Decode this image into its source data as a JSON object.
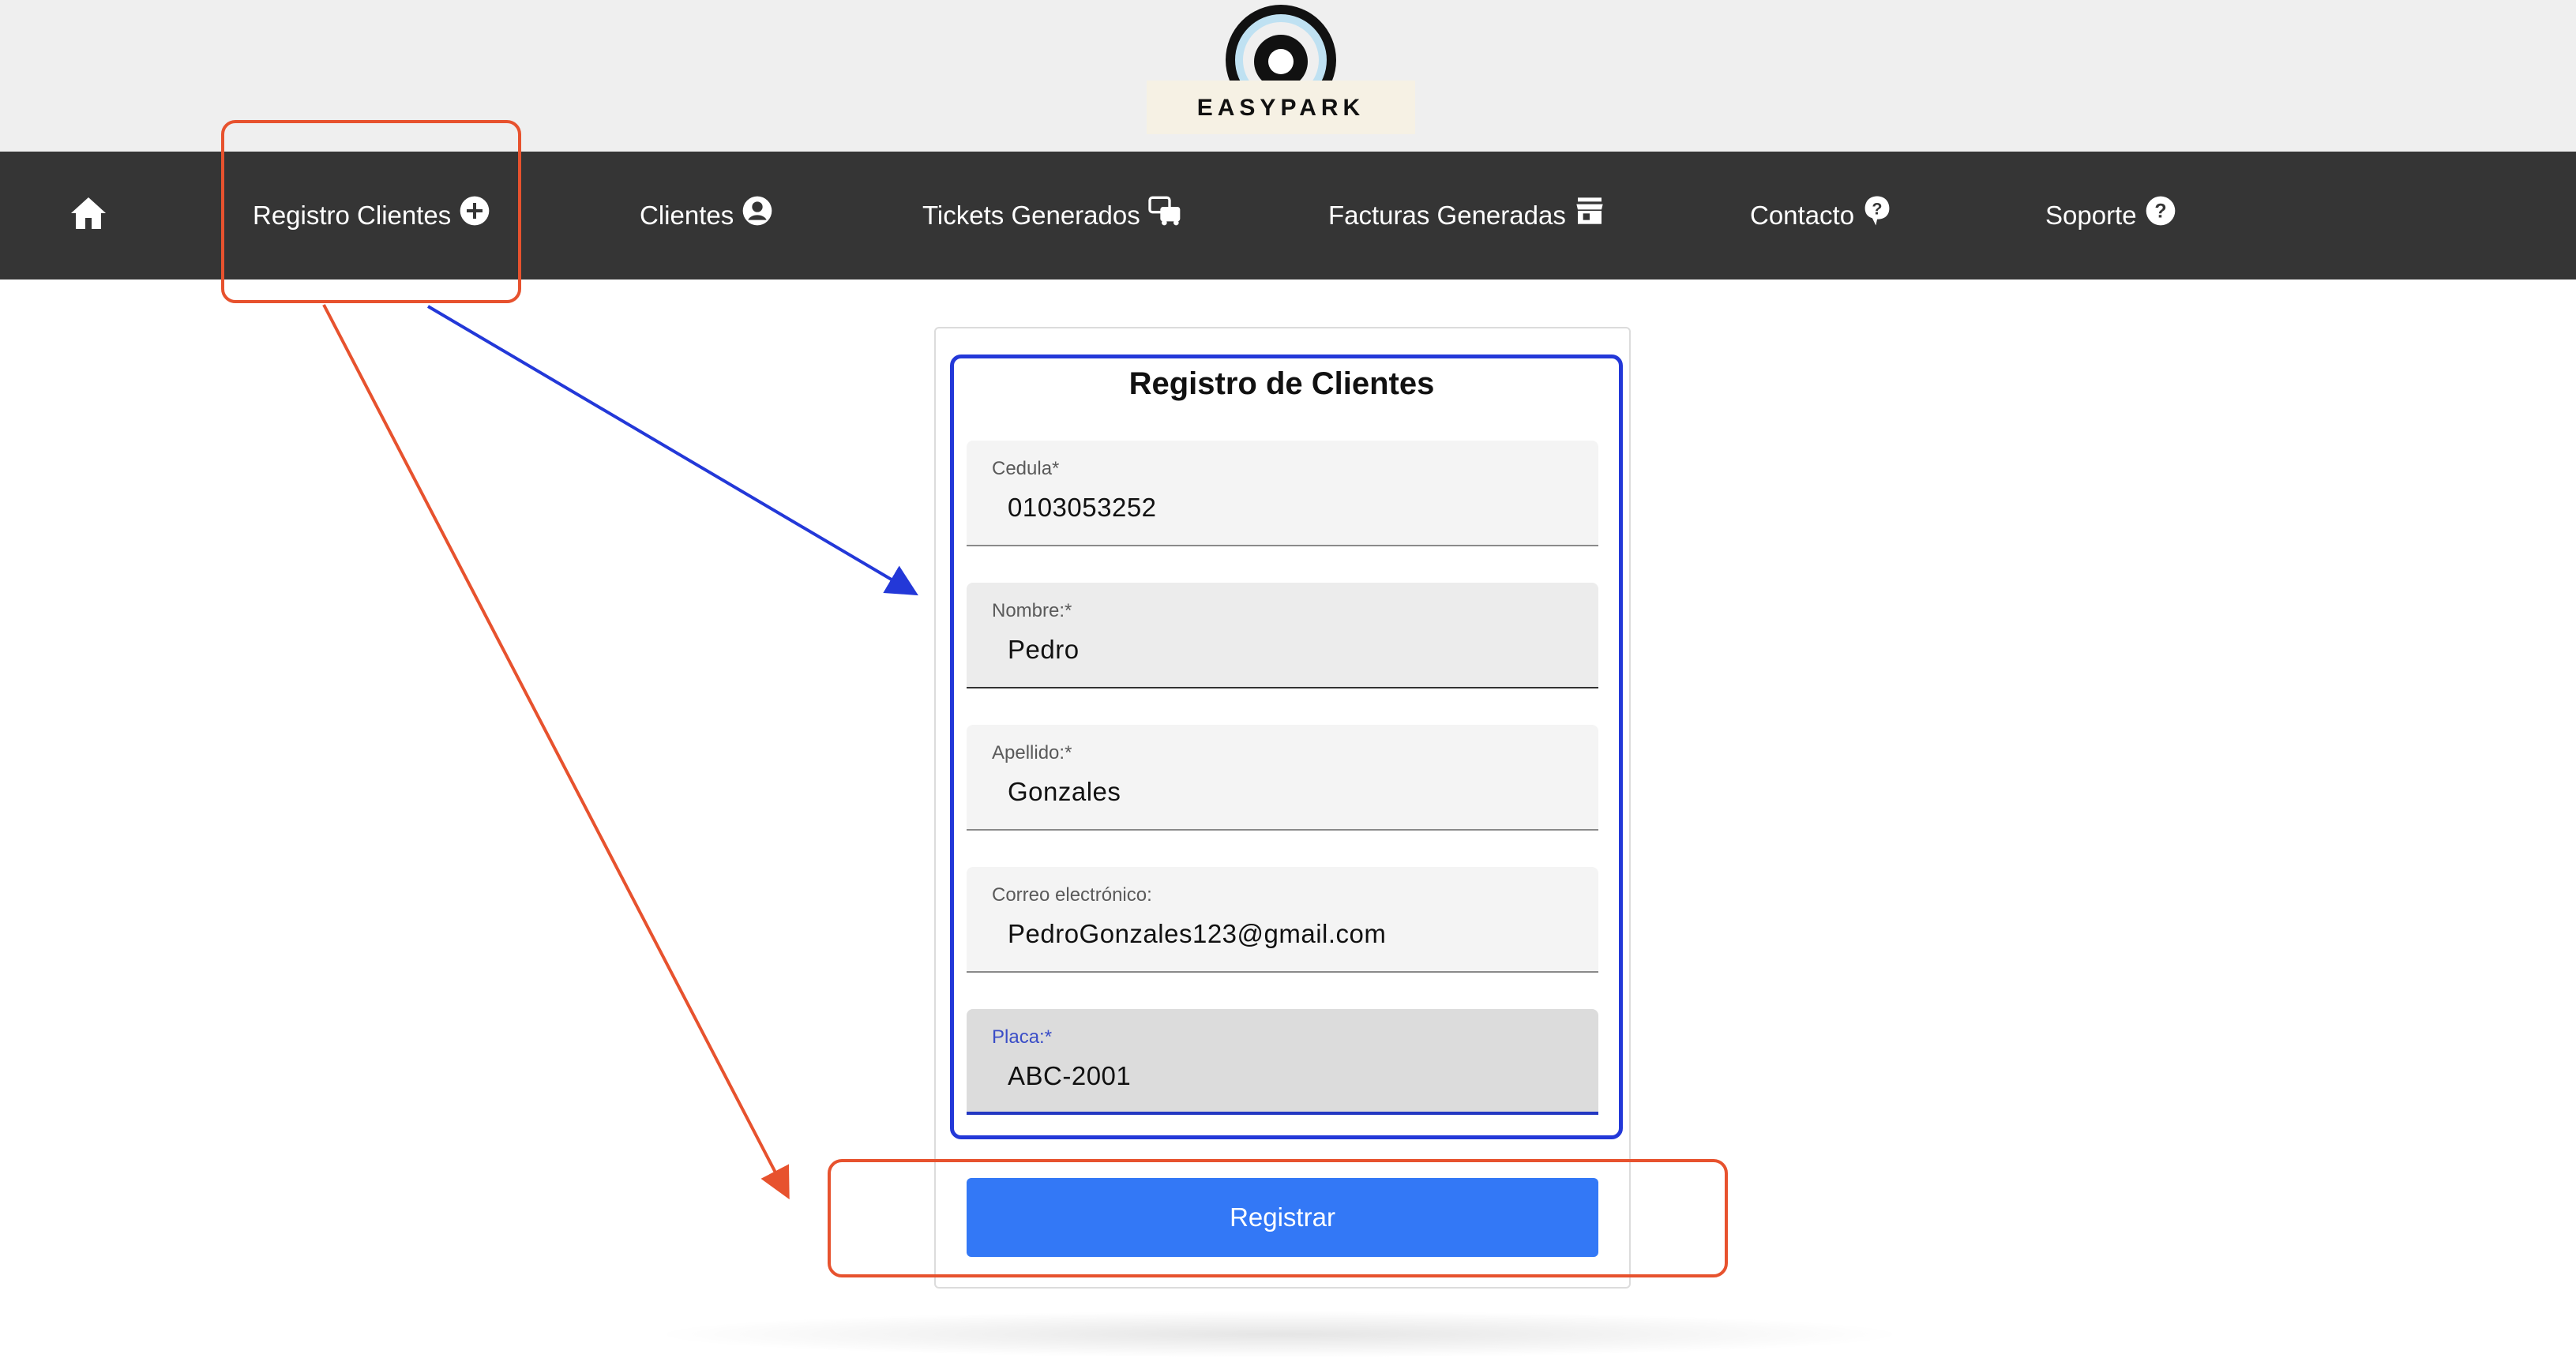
{
  "brand": {
    "name": "EASYPARK"
  },
  "nav": {
    "home_icon": "home-icon",
    "items": [
      {
        "label": "Registro Clientes",
        "icon": "plus-circle-icon"
      },
      {
        "label": "Clientes",
        "icon": "account-circle-icon"
      },
      {
        "label": "Tickets Generados",
        "icon": "cars-icon"
      },
      {
        "label": "Facturas Generadas",
        "icon": "store-icon"
      },
      {
        "label": "Contacto",
        "icon": "help-bubble-icon"
      },
      {
        "label": "Soporte",
        "icon": "help-circle-icon"
      }
    ]
  },
  "form": {
    "title": "Registro de Clientes",
    "fields": [
      {
        "label": "Cedula*",
        "value": "0103053252"
      },
      {
        "label": "Nombre:*",
        "value": "Pedro"
      },
      {
        "label": "Apellido:*",
        "value": "Gonzales"
      },
      {
        "label": "Correo electrónico:",
        "value": "PedroGonzales123@gmail.com"
      },
      {
        "label": "Placa:*",
        "value": "ABC-2001"
      }
    ],
    "submit_label": "Registrar"
  },
  "colors": {
    "navbar": "#353535",
    "button": "#3378f6",
    "annotation_red": "#e7522e",
    "annotation_blue": "#2338d8"
  }
}
